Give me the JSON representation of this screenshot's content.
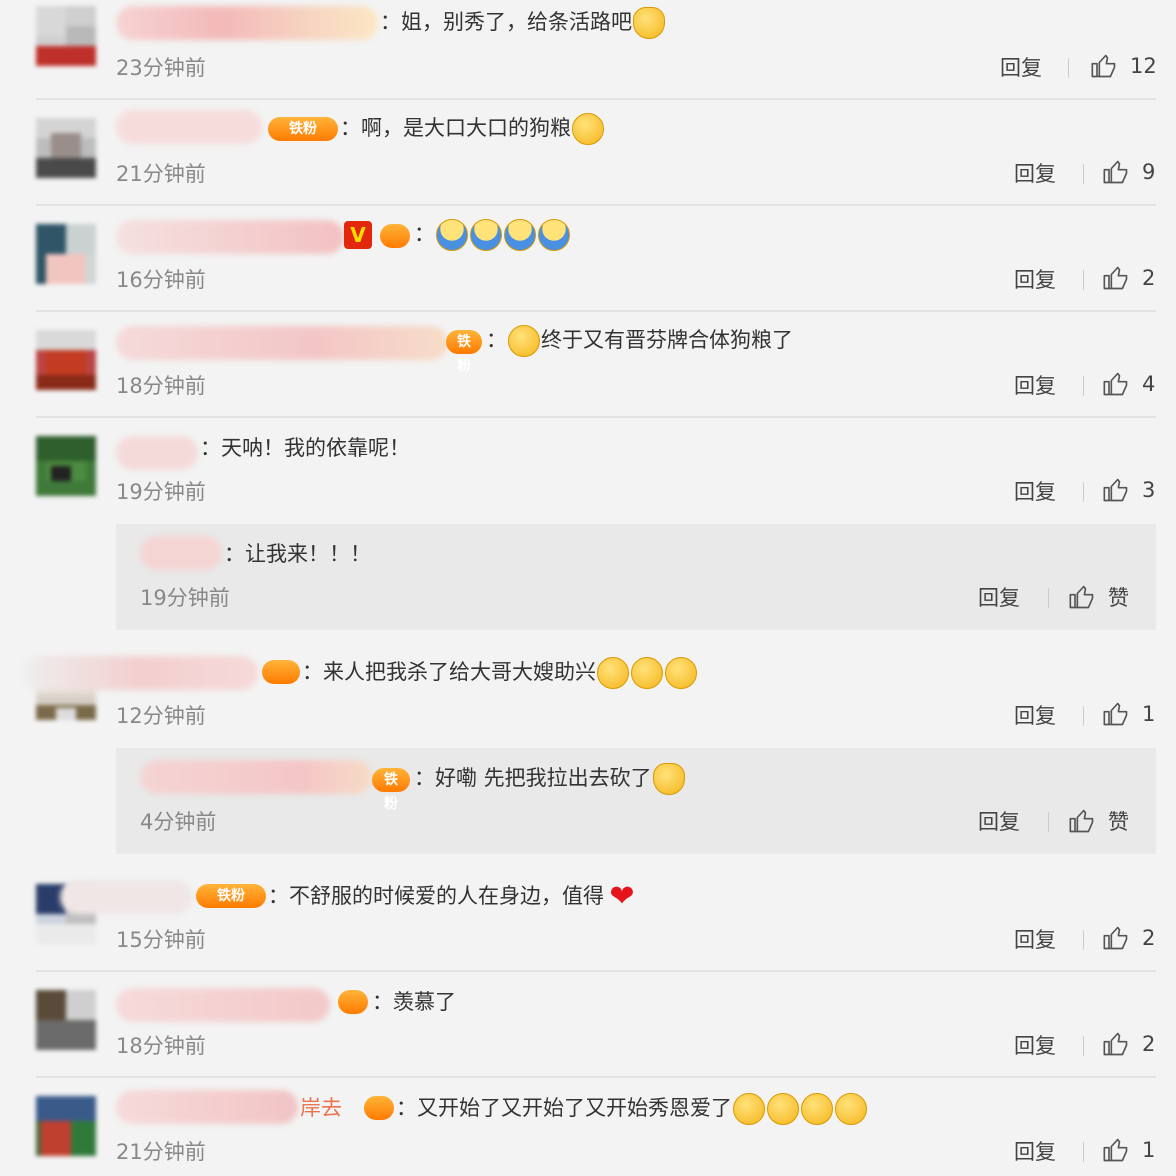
{
  "colors": {
    "background": "#f3f3f3",
    "reply_box": "#e9e9e9",
    "badge": "#ff8a00",
    "heart": "#e5141b"
  },
  "comments": [
    {
      "id": "c1",
      "badge_label": "",
      "text": "：姐，别秀了，给条活路吧",
      "emojis": [
        "person-emoji"
      ],
      "time": "23分钟前",
      "reply_label": "回复",
      "likes": "12"
    },
    {
      "id": "c2",
      "badge_label": "铁粉",
      "text": "：啊，是大口大口的狗粮",
      "emojis": [
        "grin-emoji"
      ],
      "time": "21分钟前",
      "reply_label": "回复",
      "likes": "9"
    },
    {
      "id": "c3",
      "badge_label": "",
      "text": "：",
      "emojis": [
        "hug-emoji",
        "hug-emoji",
        "hug-emoji",
        "hug-emoji"
      ],
      "time": "16分钟前",
      "reply_label": "回复",
      "likes": "2"
    },
    {
      "id": "c4",
      "badge_label": "铁粉",
      "text": "终于又有晋芬牌合体狗粮了",
      "emojis": [
        "cute-emoji"
      ],
      "time": "18分钟前",
      "reply_label": "回复",
      "likes": "4"
    },
    {
      "id": "c5",
      "badge_label": "",
      "text": "：天呐！我的依靠呢！",
      "emojis": [],
      "time": "19分钟前",
      "reply_label": "回复",
      "likes": "3",
      "reply": {
        "text": "：让我来！！！",
        "time": "19分钟前",
        "reply_label": "回复",
        "likes": "赞"
      }
    },
    {
      "id": "c6",
      "badge_label": "",
      "text": "：来人把我杀了给大哥大嫂助兴",
      "emojis": [
        "cat-emoji",
        "cat-emoji",
        "cat-emoji"
      ],
      "time": "12分钟前",
      "reply_label": "回复",
      "likes": "1",
      "reply": {
        "badge_label": "铁粉",
        "text": "：好嘞 先把我拉出去砍了",
        "time": "4分钟前",
        "reply_label": "回复",
        "likes": "赞"
      }
    },
    {
      "id": "c7",
      "badge_label": "铁粉",
      "text": "：不舒服的时候爱的人在身边，值得",
      "emojis": [
        "heart-emoji"
      ],
      "time": "15分钟前",
      "reply_label": "回复",
      "likes": "2"
    },
    {
      "id": "c8",
      "badge_label": "",
      "text": "：羡慕了",
      "emojis": [],
      "time": "18分钟前",
      "reply_label": "回复",
      "likes": "2"
    },
    {
      "id": "c9",
      "badge_label": "",
      "name_fragment": "岸去",
      "text": "：又开始了又开始了又开始秀恩爱了",
      "emojis": [
        "cover-face-emoji",
        "cover-face-emoji",
        "cover-face-emoji",
        "smirk-emoji"
      ],
      "time": "21分钟前",
      "reply_label": "回复",
      "likes": "1"
    }
  ]
}
